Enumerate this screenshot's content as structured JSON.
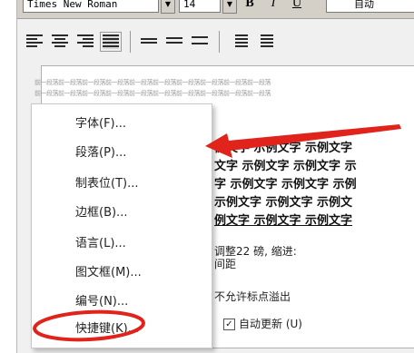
{
  "toolbar": {
    "font_name": "Times New Roman",
    "font_size": "14",
    "bold": "B",
    "italic": "I",
    "underline": "U",
    "color_value": "自动"
  },
  "preview": {
    "grey_text": "前一段落前一段落前一段落前一段落前一段落前一段落前一段落前一段落前一段落前一段落",
    "sample_lines": [
      "例文字 示例文字 示例文字",
      "文字 示例文字 示例文字 示",
      "字 示例文字 示例文字 示例",
      "示例文字 示例文字 示例文",
      "例文字 示例文字 示例文字"
    ],
    "desc_line1": "调整22 磅, 缩进:",
    "desc_line2": "间距",
    "overflow_option": "不允许标点溢出"
  },
  "context_menu": {
    "items": [
      "字体(F)...",
      "段落(P)...",
      "制表位(T)...",
      "边框(B)...",
      "语言(L)...",
      "图文框(M)...",
      "编号(N)...",
      "快捷键(K)..."
    ]
  },
  "options": {
    "auto_update_label": "自动更新 (U)",
    "auto_update_checked": true
  },
  "colors": {
    "annotation_red": "#e0231b"
  }
}
